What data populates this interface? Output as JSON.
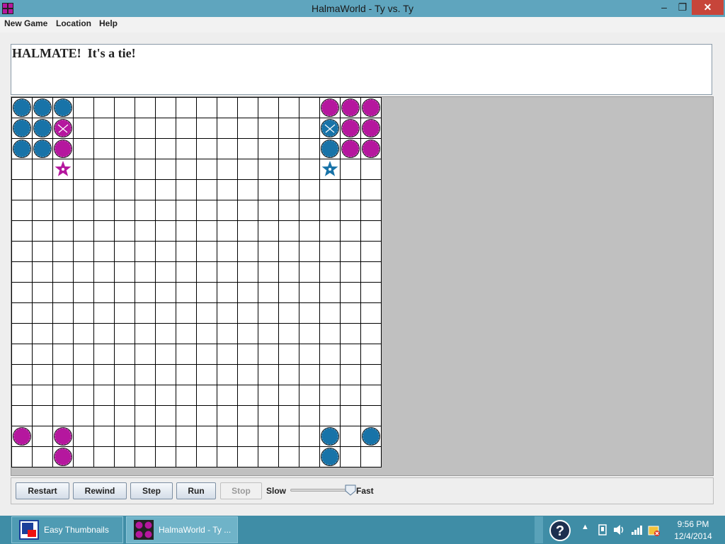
{
  "window": {
    "title": "HalmaWorld - Ty vs. Ty"
  },
  "menu": {
    "new_game": "New Game",
    "location": "Location",
    "help": "Help"
  },
  "message": "HALMATE!  It's a tie!",
  "board": {
    "rows": 18,
    "cols": 18,
    "pieces": [
      {
        "row": 0,
        "col": 0,
        "color": "blue"
      },
      {
        "row": 0,
        "col": 1,
        "color": "blue"
      },
      {
        "row": 0,
        "col": 2,
        "color": "blue"
      },
      {
        "row": 1,
        "col": 0,
        "color": "blue"
      },
      {
        "row": 1,
        "col": 1,
        "color": "blue"
      },
      {
        "row": 1,
        "col": 2,
        "color": "magenta",
        "marked": true
      },
      {
        "row": 2,
        "col": 0,
        "color": "blue"
      },
      {
        "row": 2,
        "col": 1,
        "color": "blue"
      },
      {
        "row": 2,
        "col": 2,
        "color": "magenta"
      },
      {
        "row": 3,
        "col": 2,
        "color": "magenta",
        "star": true
      },
      {
        "row": 0,
        "col": 15,
        "color": "magenta"
      },
      {
        "row": 0,
        "col": 16,
        "color": "magenta"
      },
      {
        "row": 0,
        "col": 17,
        "color": "magenta"
      },
      {
        "row": 1,
        "col": 15,
        "color": "blue",
        "marked": true
      },
      {
        "row": 1,
        "col": 16,
        "color": "magenta"
      },
      {
        "row": 1,
        "col": 17,
        "color": "magenta"
      },
      {
        "row": 2,
        "col": 15,
        "color": "blue"
      },
      {
        "row": 2,
        "col": 16,
        "color": "magenta"
      },
      {
        "row": 2,
        "col": 17,
        "color": "magenta"
      },
      {
        "row": 3,
        "col": 15,
        "color": "blue",
        "star": true
      },
      {
        "row": 16,
        "col": 0,
        "color": "magenta"
      },
      {
        "row": 16,
        "col": 2,
        "color": "magenta"
      },
      {
        "row": 17,
        "col": 2,
        "color": "magenta"
      },
      {
        "row": 16,
        "col": 15,
        "color": "blue"
      },
      {
        "row": 16,
        "col": 17,
        "color": "blue"
      },
      {
        "row": 17,
        "col": 15,
        "color": "blue"
      }
    ],
    "colors": {
      "blue": "#1873a8",
      "magenta": "#b5179e"
    }
  },
  "controls": {
    "restart": "Restart",
    "rewind": "Rewind",
    "step": "Step",
    "run": "Run",
    "stop": "Stop",
    "slow": "Slow",
    "fast": "Fast",
    "speed_fraction": 0.9
  },
  "taskbar": {
    "thumbs_label": "Easy Thumbnails",
    "halma_label": "HalmaWorld - Ty ...",
    "time": "9:56 PM",
    "date": "12/4/2014"
  }
}
